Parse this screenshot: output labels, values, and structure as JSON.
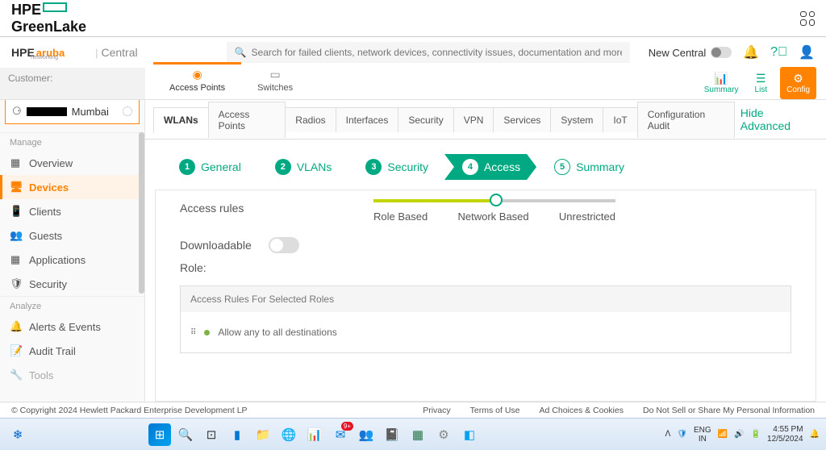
{
  "greenlake": {
    "brand1": "HPE",
    "brand2": "GreenLake"
  },
  "aruba": {
    "brand1": "HPE",
    "brand2": "aruba",
    "sub": "networking",
    "product": "Central"
  },
  "search": {
    "placeholder": "Search for failed clients, network devices, connectivity issues, documentation and more"
  },
  "header": {
    "new_central": "New Central"
  },
  "customer": {
    "label": "Customer:",
    "location": "Mumbai"
  },
  "view_tabs": {
    "ap": "Access Points",
    "sw": "Switches"
  },
  "actions": {
    "summary": "Summary",
    "list": "List",
    "config": "Config"
  },
  "sidebar": {
    "sections": {
      "manage": "Manage",
      "analyze": "Analyze"
    },
    "items": {
      "overview": "Overview",
      "devices": "Devices",
      "clients": "Clients",
      "guests": "Guests",
      "applications": "Applications",
      "security": "Security",
      "alerts": "Alerts & Events",
      "audit": "Audit Trail",
      "tools": "Tools"
    }
  },
  "subtabs": {
    "wlans": "WLANs",
    "ap": "Access Points",
    "radios": "Radios",
    "interfaces": "Interfaces",
    "security": "Security",
    "vpn": "VPN",
    "services": "Services",
    "system": "System",
    "iot": "IoT",
    "audit": "Configuration Audit",
    "hide": "Hide Advanced"
  },
  "wizard": {
    "s1": "General",
    "s2": "VLANs",
    "s3": "Security",
    "s4": "Access",
    "s5": "Summary"
  },
  "content": {
    "access_rules": "Access rules",
    "slider": {
      "l1": "Role Based",
      "l2": "Network Based",
      "l3": "Unrestricted"
    },
    "downloadable": "Downloadable",
    "role": "Role:",
    "rules_header": "Access Rules For Selected Roles",
    "rule1": "Allow any to all destinations"
  },
  "footer": {
    "copyright": "© Copyright 2024 Hewlett Packard Enterprise Development LP",
    "links": {
      "privacy": "Privacy",
      "terms": "Terms of Use",
      "ads": "Ad Choices & Cookies",
      "donotsell": "Do Not Sell or Share My Personal Information"
    }
  },
  "taskbar": {
    "lang1": "ENG",
    "lang2": "IN",
    "time": "4:55 PM",
    "date": "12/5/2024"
  }
}
